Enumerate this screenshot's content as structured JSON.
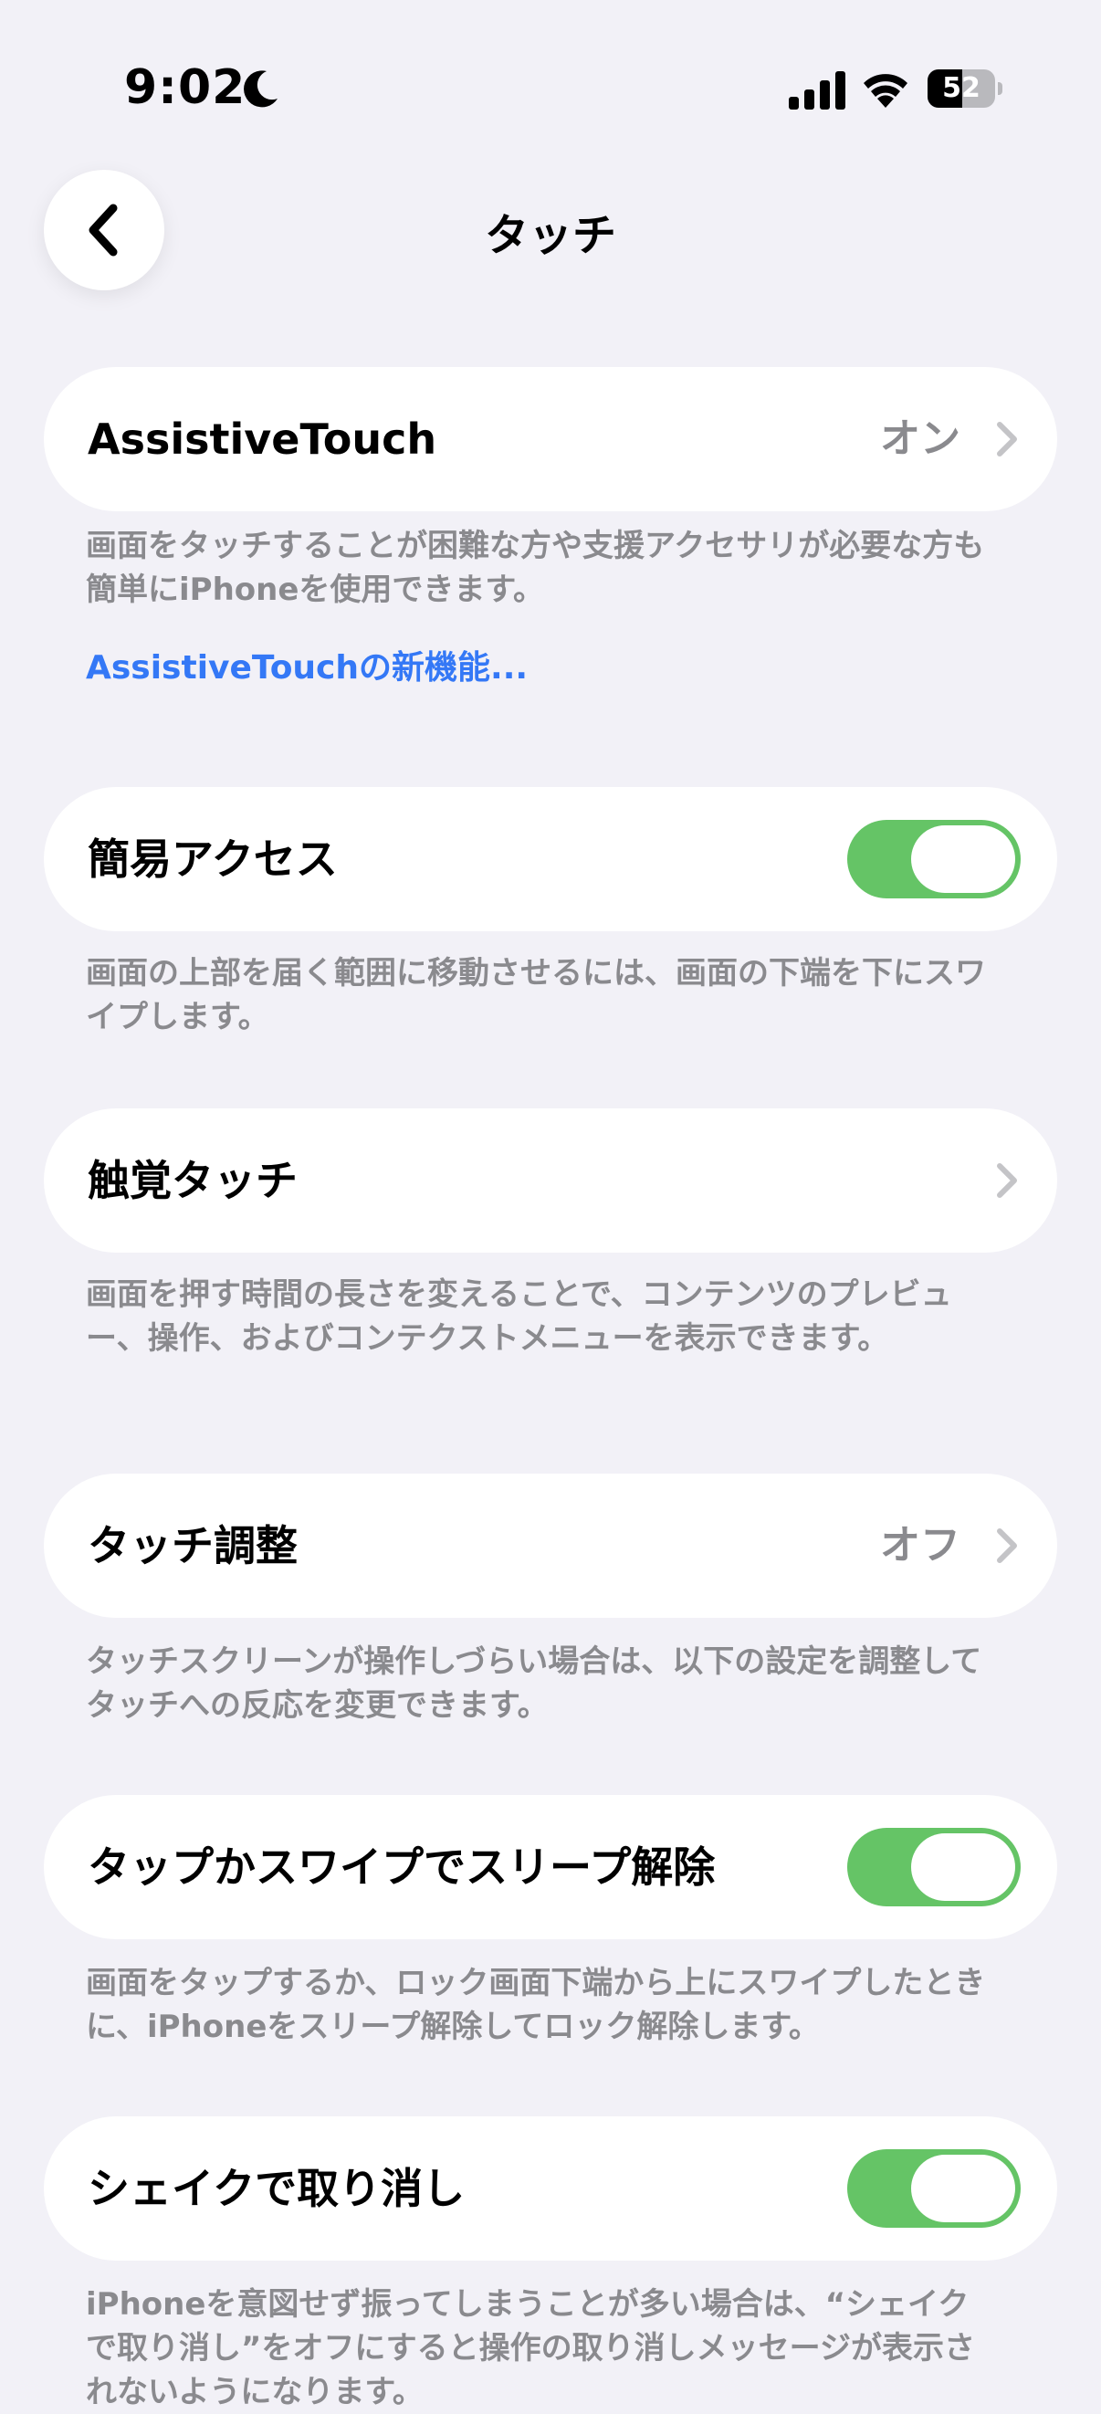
{
  "status_bar": {
    "time": "9:02",
    "battery_percent": 52,
    "battery_label": "52"
  },
  "nav": {
    "title": "タッチ"
  },
  "rows": [
    {
      "label": "AssistiveTouch",
      "value": "オン"
    },
    {
      "label": "簡易アクセス",
      "toggle_on": true
    },
    {
      "label": "触覚タッチ"
    },
    {
      "label": "タッチ調整",
      "value": "オフ"
    },
    {
      "label": "タップかスワイプでスリープ解除",
      "toggle_on": true
    },
    {
      "label": "シェイクで取り消し",
      "toggle_on": true
    }
  ],
  "footers": {
    "assistivetouch": "画面をタッチすることが困難な方や支援アクセサリが必要な方も簡単にiPhoneを使用できます。",
    "assistivetouch_link": "AssistiveTouchの新機能...",
    "reachability": "画面の上部を届く範囲に移動させるには、画面の下端を下にスワイプします。",
    "haptic_touch": "画面を押す時間の長さを変えることで、コンテンツのプレビュー、操作、およびコンテクストメニューを表示できます。",
    "touch_accommodations": "タッチスクリーンが操作しづらい場合は、以下の設定を調整してタッチへの反応を変更できます。",
    "tap_to_wake": "画面をタップするか、ロック画面下端から上にスワイプしたときに、iPhoneをスリープ解除してロック解除します。",
    "shake_to_undo": "iPhoneを意図せず振ってしまうことが多い場合は、“シェイクで取り消し”をオフにすると操作の取り消しメッセージが表示されないようになります。"
  },
  "colors": {
    "background": "#f2f1f7",
    "toggle_on": "#65c466",
    "link": "#3478f6",
    "secondary_text": "#8a8a8e"
  }
}
